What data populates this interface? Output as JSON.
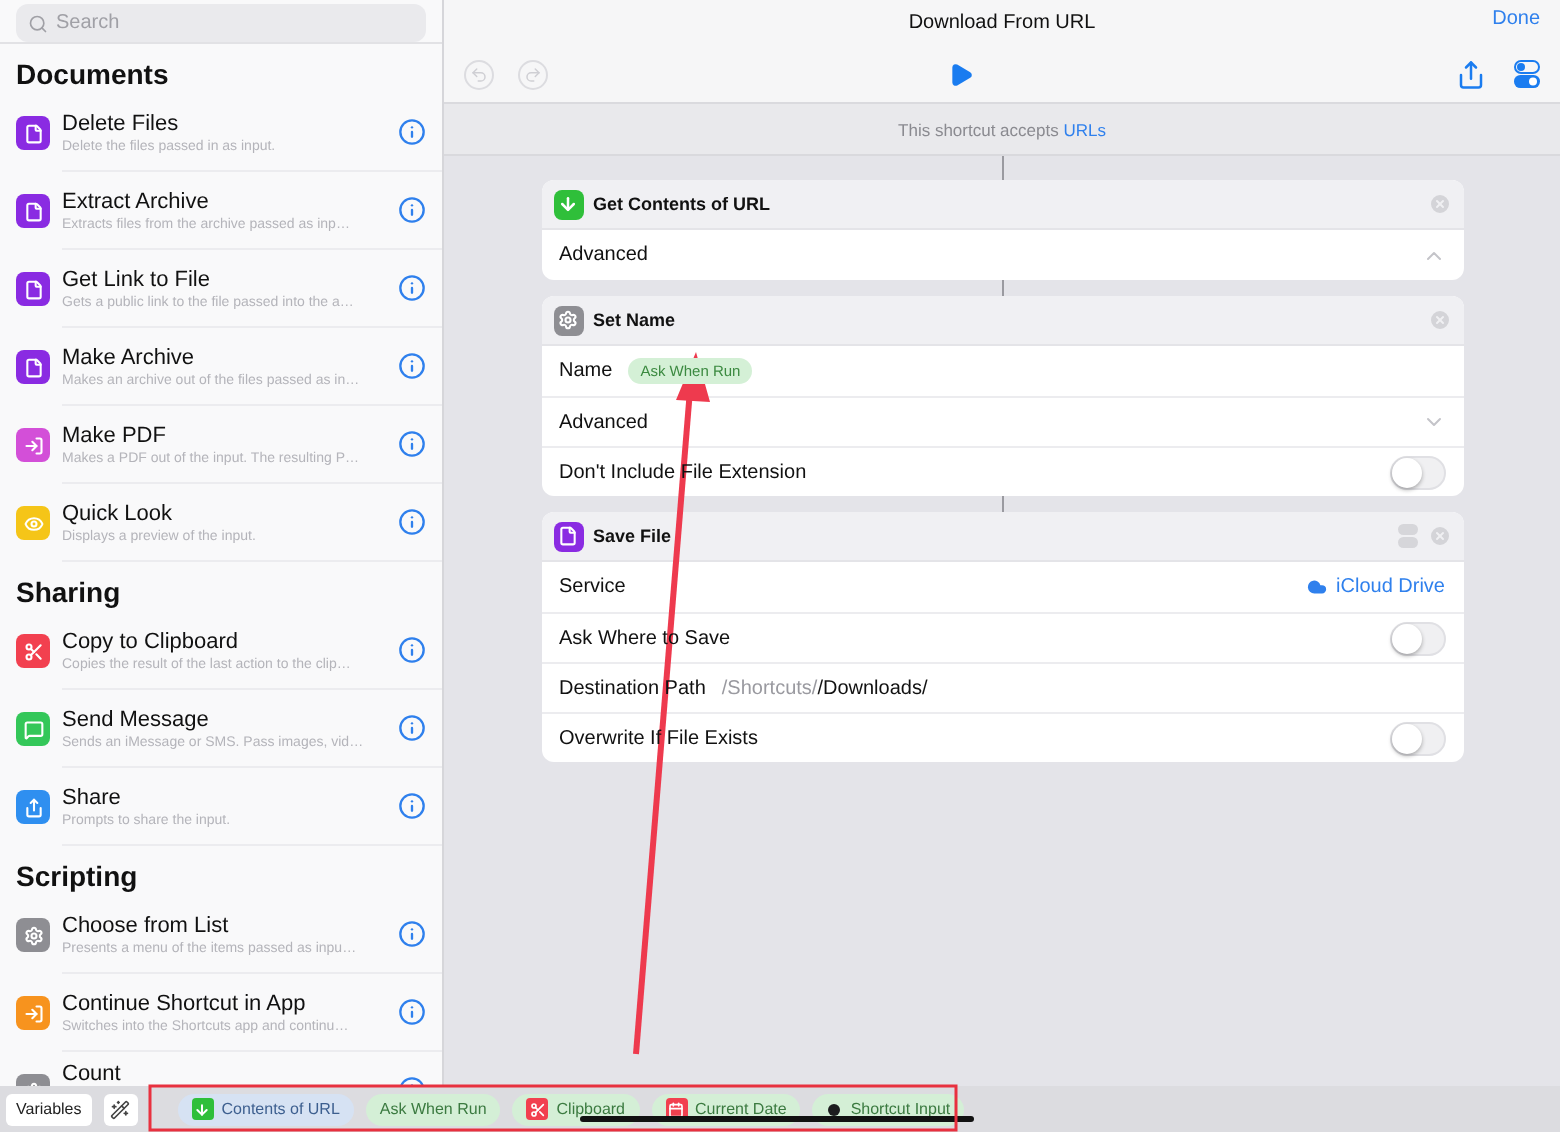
{
  "sidebar": {
    "search": {
      "placeholder": "Search"
    },
    "sections": [
      {
        "title": "Documents",
        "items": [
          {
            "title": "Delete Files",
            "description": "Delete the files passed in as input.",
            "kind": "file",
            "color": "#8a2be2"
          },
          {
            "title": "Extract Archive",
            "description": "Extracts files from the archive passed as inp…",
            "kind": "file",
            "color": "#8a2be2"
          },
          {
            "title": "Get Link to File",
            "description": "Gets a public link to the file passed into the a…",
            "kind": "file",
            "color": "#8a2be2"
          },
          {
            "title": "Make Archive",
            "description": "Makes an archive out of the files passed as in…",
            "kind": "file",
            "color": "#8a2be2"
          },
          {
            "title": "Make PDF",
            "description": "Makes a PDF out of the input. The resulting P…",
            "kind": "pdf",
            "color": "#d34fd8"
          },
          {
            "title": "Quick Look",
            "description": "Displays a preview of the input.",
            "kind": "preview",
            "color": "#f5c518"
          }
        ]
      },
      {
        "title": "Sharing",
        "items": [
          {
            "title": "Copy to Clipboard",
            "description": "Copies the result of the last action to the clip…",
            "kind": "clipboard",
            "color": "#f2404f"
          },
          {
            "title": "Send Message",
            "description": "Sends an iMessage or SMS. Pass images, vid…",
            "kind": "message",
            "color": "#34c759"
          },
          {
            "title": "Share",
            "description": "Prompts to share the input.",
            "kind": "share",
            "color": "#2f8ff0"
          }
        ]
      },
      {
        "title": "Scripting",
        "items": [
          {
            "title": "Choose from List",
            "description": "Presents a menu of the items passed as inpu…",
            "kind": "list",
            "color": "#8e8e93"
          },
          {
            "title": "Continue Shortcut in App",
            "description": "Switches into the Shortcuts app and continu…",
            "kind": "app",
            "color": "#f7931e"
          },
          {
            "title": "Count",
            "kind": "list",
            "color": "#8e8e93"
          }
        ]
      }
    ]
  },
  "header": {
    "title": "Download From URL",
    "done": "Done"
  },
  "accepts": {
    "text": "This shortcut accepts ",
    "link": "URLs"
  },
  "actions": [
    {
      "title": "Get Contents of URL",
      "kind": "download",
      "color": "#2fbf3a",
      "rows": [
        {
          "kind": "disclosure",
          "label": "Advanced",
          "expanded": true
        }
      ]
    },
    {
      "title": "Set Name",
      "kind": "gear",
      "color": "#8e8e93",
      "rows": [
        {
          "kind": "parameter",
          "label": "Name",
          "token": "Ask When Run"
        },
        {
          "kind": "disclosure",
          "label": "Advanced",
          "expanded": false
        },
        {
          "kind": "toggle",
          "label": "Don't Include File Extension",
          "on": false
        }
      ]
    },
    {
      "title": "Save File",
      "kind": "file",
      "color": "#8a2be2",
      "settings": true,
      "rows": [
        {
          "kind": "service",
          "label": "Service",
          "value": "iCloud Drive"
        },
        {
          "kind": "toggle",
          "label": "Ask Where to Save",
          "on": false
        },
        {
          "kind": "path",
          "label": "Destination Path",
          "prefix": "/Shortcuts/",
          "value": "/Downloads/"
        },
        {
          "kind": "toggle",
          "label": "Overwrite If File Exists",
          "on": false
        }
      ]
    }
  ],
  "bottom_bar": {
    "variables": "Variables",
    "chips": [
      {
        "label": "Contents of URL",
        "kind": "download",
        "color": "#2fbf3a",
        "selected": true
      },
      {
        "label": "Ask When Run",
        "kind": "plain",
        "selected": false
      },
      {
        "label": "Clipboard",
        "kind": "clipboard",
        "color": "#f2404f",
        "selected": false
      },
      {
        "label": "Current Date",
        "kind": "date",
        "color": "#f2404f",
        "selected": false
      },
      {
        "label": "Shortcut Input",
        "kind": "input",
        "color": "#1c1c1e",
        "selected": false
      }
    ]
  }
}
